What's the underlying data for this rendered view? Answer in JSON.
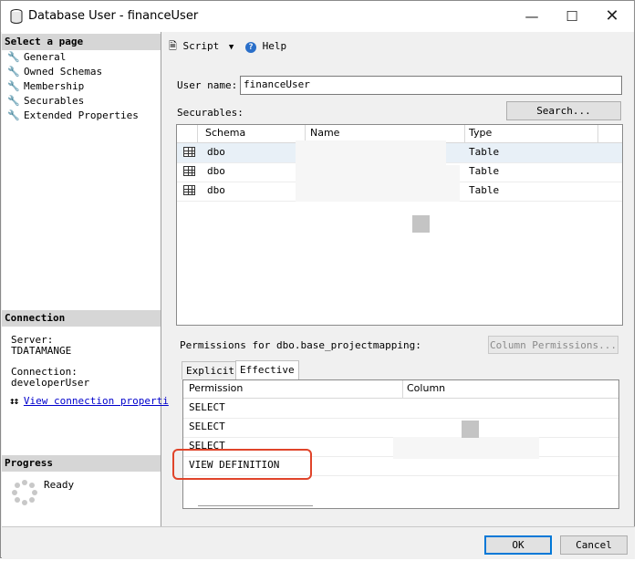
{
  "window": {
    "title": "Database User - financeUser"
  },
  "left": {
    "select_header": "Select a page",
    "pages": [
      "General",
      "Owned Schemas",
      "Membership",
      "Securables",
      "Extended Properties"
    ],
    "connection_header": "Connection",
    "server_label": "Server:",
    "server_value": "TDATAMANGE",
    "connection_label": "Connection:",
    "connection_value": "developerUser",
    "view_link": "View connection properti",
    "progress_header": "Progress",
    "progress_status": "Ready"
  },
  "toolbar": {
    "script": "Script",
    "help": "Help"
  },
  "form": {
    "user_name_label": "User name:",
    "user_name_value": "financeUser",
    "securables_label": "Securables:",
    "search_button": "Search...",
    "securables_columns": [
      "Schema",
      "Name",
      "Type"
    ],
    "securables_rows": [
      {
        "schema": "dbo",
        "type": "Table"
      },
      {
        "schema": "dbo",
        "type": "Table"
      },
      {
        "schema": "dbo",
        "type": "Table"
      }
    ],
    "permissions_label": "Permissions for dbo.base_projectmapping:",
    "column_permissions_button": "Column Permissions...",
    "tabs": [
      "Explicit",
      "Effective"
    ],
    "perm_columns": [
      "Permission",
      "Column"
    ],
    "perm_rows": [
      "SELECT",
      "SELECT",
      "SELECT",
      "VIEW DEFINITION"
    ]
  },
  "buttons": {
    "ok": "OK",
    "cancel": "Cancel"
  },
  "colors": {
    "highlight": "#e0442a",
    "accent": "#0078d7"
  }
}
